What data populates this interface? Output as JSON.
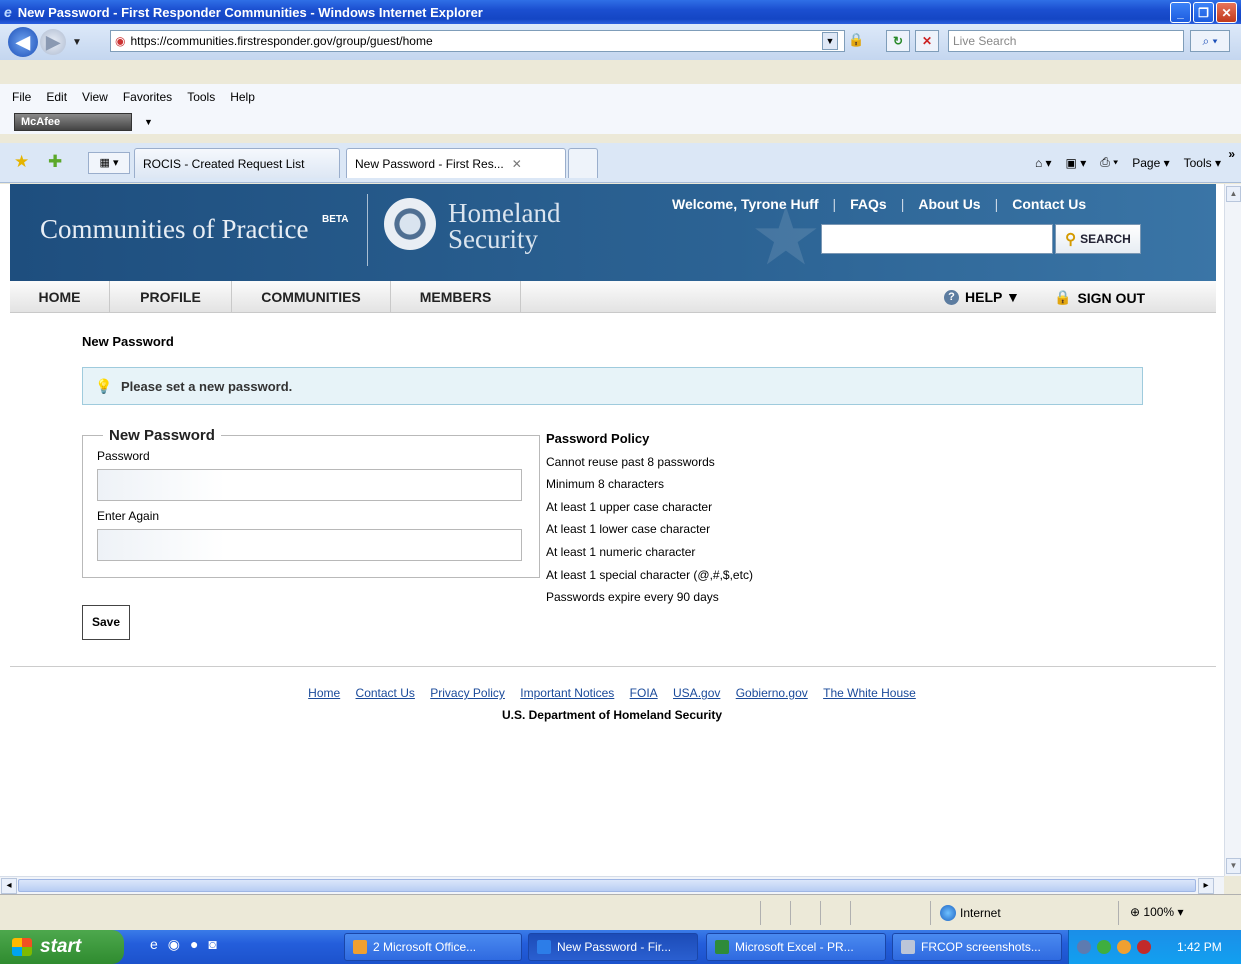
{
  "window": {
    "title": "New Password - First Responder Communities - Windows Internet Explorer",
    "buttons": [
      "_",
      "❐",
      "✕"
    ]
  },
  "addressbar": {
    "url": "https://communities.firstresponder.gov/group/guest/home",
    "search_placeholder": "Live Search"
  },
  "menubar": {
    "items": [
      "File",
      "Edit",
      "View",
      "Favorites",
      "Tools",
      "Help"
    ]
  },
  "mcafee": {
    "label": "McAfee"
  },
  "tabs": [
    {
      "label": "ROCIS - Created Request List",
      "active": false
    },
    {
      "label": "New Password - First Res...",
      "active": true
    }
  ],
  "commandbar": {
    "items": [
      "Page ▾",
      "Tools ▾"
    ]
  },
  "site": {
    "title": "Communities of Practice",
    "beta": "BETA",
    "agency_line1": "Homeland",
    "agency_line2": "Security",
    "welcome": "Welcome, Tyrone Huff",
    "links": [
      "FAQs",
      "About Us",
      "Contact Us"
    ],
    "search_button": "SEARCH",
    "nav": [
      "HOME",
      "PROFILE",
      "COMMUNITIES",
      "MEMBERS"
    ],
    "help": "HELP ▼",
    "signout": "SIGN OUT"
  },
  "content": {
    "page_title": "New Password",
    "info_message": "Please set a new password.",
    "form_legend": "New Password",
    "password_label": "Password",
    "password_value": "",
    "confirm_label": "Enter Again",
    "confirm_value": "",
    "save_button": "Save",
    "policy_title": "Password Policy",
    "policy_items": [
      "Cannot reuse past 8 passwords",
      "Minimum 8 characters",
      "At least 1 upper case character",
      "At least 1 lower case character",
      "At least 1 numeric character",
      "At least 1 special character (@,#,$,etc)",
      "Passwords expire every 90 days"
    ]
  },
  "footer": {
    "links": [
      "Home",
      "Contact Us",
      "Privacy Policy",
      "Important Notices",
      "FOIA",
      "USA.gov",
      "Gobierno.gov",
      "The White House"
    ],
    "org": "U.S. Department of Homeland Security"
  },
  "statusbar": {
    "zone": "Internet",
    "zoom": "100%"
  },
  "taskbar": {
    "start": "start",
    "tasks": [
      "2 Microsoft Office...",
      "New Password - Fir...",
      "Microsoft Excel - PR...",
      "FRCOP screenshots..."
    ],
    "clock": "1:42 PM"
  },
  "colors": {
    "header_bg": "#2c6394",
    "info_bg": "#e7f3f8",
    "link": "#1a4a9a"
  }
}
